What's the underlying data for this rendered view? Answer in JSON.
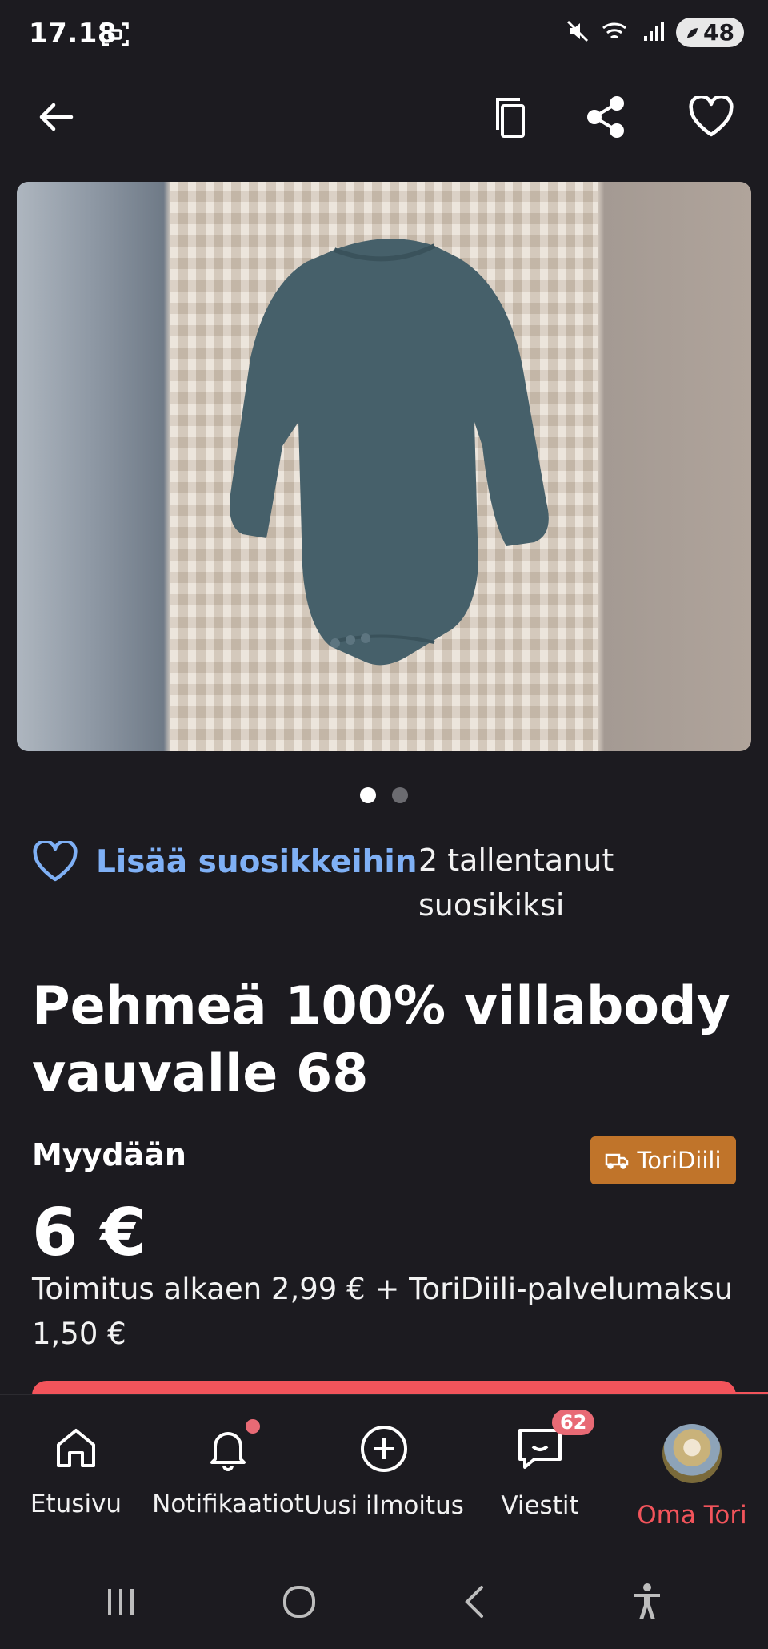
{
  "status_bar": {
    "time": "17.18",
    "battery": "48",
    "icons": [
      "screenshot-icon",
      "mute-icon",
      "wifi-icon",
      "signal-icon",
      "battery-icon"
    ]
  },
  "toolbar": {
    "icons": [
      "back-arrow-icon",
      "copy-icon",
      "share-icon",
      "heart-icon"
    ]
  },
  "gallery": {
    "image_description_name": "product-photo",
    "page_count": 2,
    "active_index": 0
  },
  "favorites": {
    "add_label": "Lisää suosikkeihin",
    "count_text": "2 tallentanut suosikiksi"
  },
  "listing": {
    "title": "Pehmeä 100% villabody vauvalle 68",
    "type_label": "Myydään",
    "badge_label": "ToriDiili",
    "price": "6 €",
    "delivery_text": "Toimitus alkaen 2,99 € + ToriDiili-palvelumaksu 1,50 €"
  },
  "bottom_nav": {
    "items": [
      {
        "label": "Etusivu",
        "icon": "home-icon"
      },
      {
        "label": "Notifikaatiot",
        "icon": "bell-icon"
      },
      {
        "label": "Uusi ilmoitus",
        "icon": "plus-circle-icon"
      },
      {
        "label": "Viestit",
        "icon": "chat-icon",
        "badge": "62"
      },
      {
        "label": "Oma Tori",
        "icon": "avatar",
        "active": true
      }
    ]
  },
  "colors": {
    "background": "#1c1b20",
    "accent_red": "#f2545b",
    "link_blue": "#7fb0f5",
    "badge_orange": "#c0742a"
  }
}
